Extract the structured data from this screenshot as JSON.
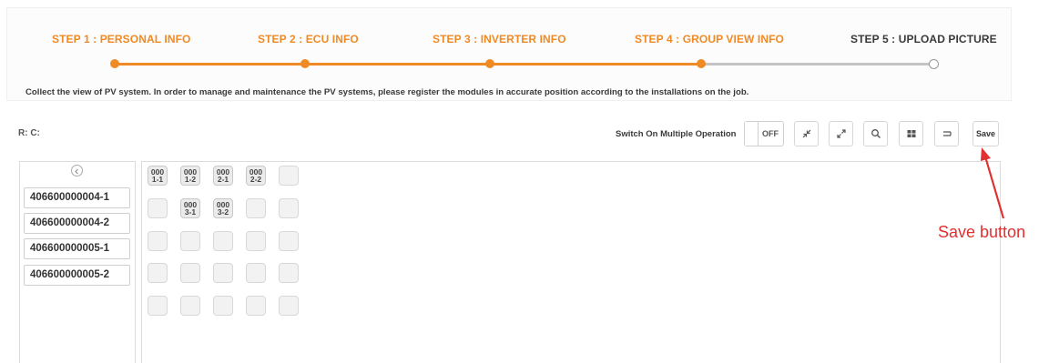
{
  "steps": [
    {
      "label": "STEP 1 : PERSONAL INFO",
      "state": "done"
    },
    {
      "label": "STEP 2 : ECU INFO",
      "state": "done"
    },
    {
      "label": "STEP 3 : INVERTER INFO",
      "state": "done"
    },
    {
      "label": "STEP 4 : GROUP VIEW INFO",
      "state": "done"
    },
    {
      "label": "STEP 5 : UPLOAD PICTURE",
      "state": "current"
    }
  ],
  "description": "Collect the view of PV system. In order to manage and maintenance the PV systems, please register the modules in accurate position according to the installations on the job.",
  "rc_label": "R: C:",
  "toolbar": {
    "multi_label": "Switch On Multiple Operation",
    "toggle_text": "OFF",
    "icons": [
      "shrink-icon",
      "expand-icon",
      "search-icon",
      "grid-icon",
      "wrap-icon"
    ],
    "save_label": "Save"
  },
  "devices": [
    "406600000004-1",
    "406600000004-2",
    "406600000005-1",
    "406600000005-2"
  ],
  "grid": {
    "cells": [
      {
        "row": 1,
        "col": 1,
        "l1": "000",
        "l2": "1-1"
      },
      {
        "row": 1,
        "col": 2,
        "l1": "000",
        "l2": "1-2"
      },
      {
        "row": 1,
        "col": 3,
        "l1": "000",
        "l2": "2-1"
      },
      {
        "row": 1,
        "col": 4,
        "l1": "000",
        "l2": "2-2"
      },
      {
        "row": 2,
        "col": 2,
        "l1": "000",
        "l2": "3-1"
      },
      {
        "row": 2,
        "col": 3,
        "l1": "000",
        "l2": "3-2"
      }
    ]
  },
  "annotation": {
    "text": "Save button",
    "color": "#e03030"
  },
  "colors": {
    "accent": "#f08a24",
    "inactive": "#c4c4c4"
  }
}
